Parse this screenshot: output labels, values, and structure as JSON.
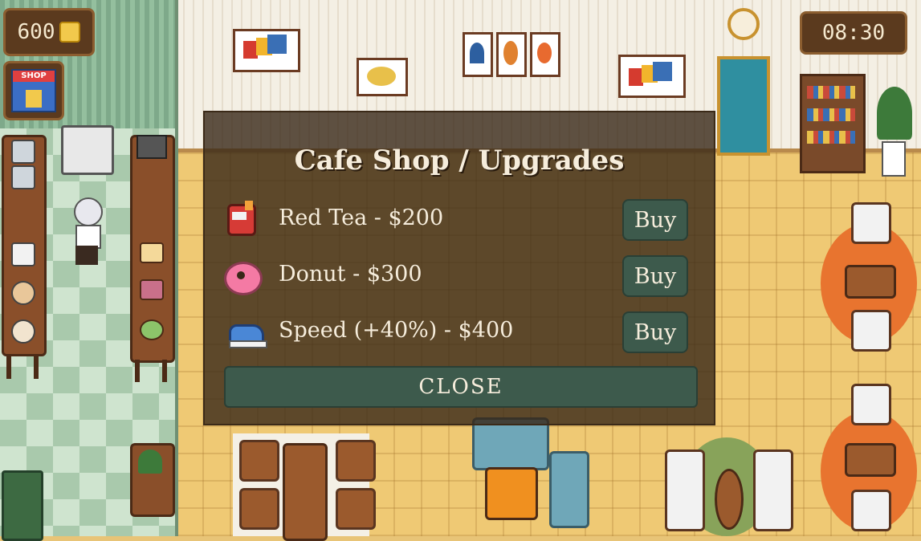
{
  "hud": {
    "coins": "600",
    "clock": "08:30",
    "shop_label": "SHOP"
  },
  "modal": {
    "title": "Cafe Shop / Upgrades",
    "items": [
      {
        "label": "Red Tea - $200",
        "button": "Buy",
        "icon": "red-tea-icon"
      },
      {
        "label": "Donut - $300",
        "button": "Buy",
        "icon": "donut-icon"
      },
      {
        "label": "Speed (+40%) - $400",
        "button": "Buy",
        "icon": "sneaker-icon"
      }
    ],
    "close_label": "CLOSE"
  },
  "colors": {
    "panel": "#382818",
    "button": "#3d5a4c",
    "text": "#f6eddc",
    "floor": "#efc974",
    "kitchen_tile": "#a9c9ac"
  }
}
